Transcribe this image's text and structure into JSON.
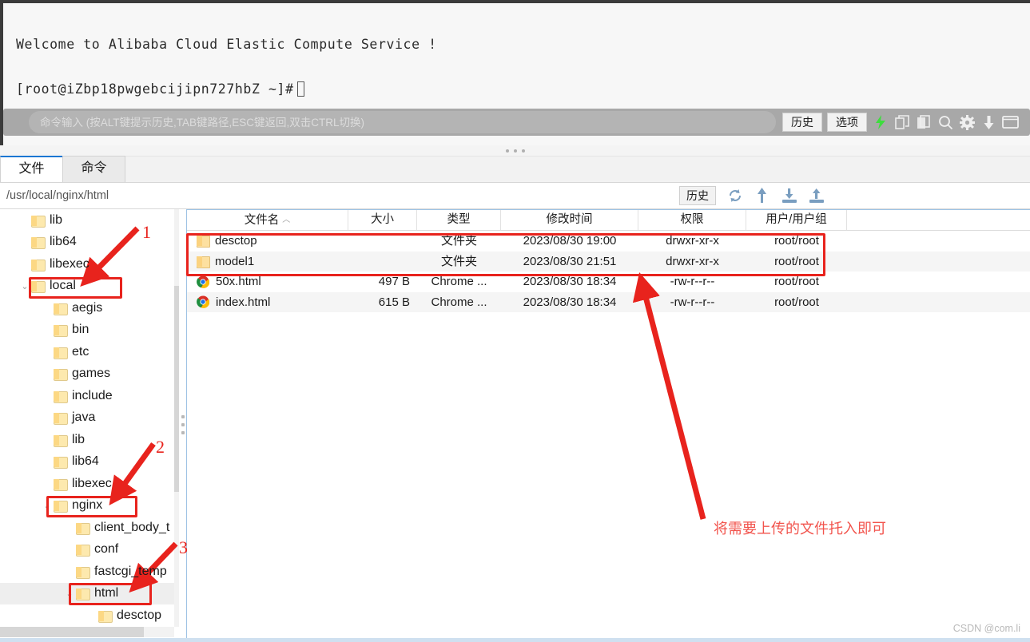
{
  "terminal": {
    "welcome": "Welcome to Alibaba Cloud Elastic Compute Service !",
    "prompt": "[root@iZbp18pwgebcijipn727hbZ ~]#"
  },
  "command_bar": {
    "placeholder": "命令输入 (按ALT键提示历史,TAB键路径,ESC键返回,双击CTRL切换)",
    "value": "",
    "history_label": "历史",
    "options_label": "选项",
    "icons": [
      "lightning-icon",
      "copy-icon",
      "paste-icon",
      "search-icon",
      "gear-icon",
      "download-icon",
      "window-icon"
    ],
    "accent_green": "#3ddd3d",
    "bar_background": "#a8a8a8"
  },
  "tabs": [
    {
      "label": "文件",
      "active": true
    },
    {
      "label": "命令",
      "active": false
    }
  ],
  "path_bar": {
    "path": "/usr/local/nginx/html",
    "history_label": "历史",
    "icons": [
      "refresh-icon",
      "parent-dir-icon",
      "download-file-icon",
      "upload-file-icon"
    ]
  },
  "tree": {
    "items": [
      {
        "label": "lib",
        "indent": 1,
        "chevron": "",
        "selected": false,
        "boxed": false
      },
      {
        "label": "lib64",
        "indent": 1,
        "chevron": "",
        "selected": false,
        "boxed": false
      },
      {
        "label": "libexec",
        "indent": 1,
        "chevron": "",
        "selected": false,
        "boxed": false
      },
      {
        "label": "local",
        "indent": 1,
        "chevron": "v",
        "selected": false,
        "boxed": true
      },
      {
        "label": "aegis",
        "indent": 2,
        "chevron": "",
        "selected": false,
        "boxed": false
      },
      {
        "label": "bin",
        "indent": 2,
        "chevron": "",
        "selected": false,
        "boxed": false
      },
      {
        "label": "etc",
        "indent": 2,
        "chevron": "",
        "selected": false,
        "boxed": false
      },
      {
        "label": "games",
        "indent": 2,
        "chevron": "",
        "selected": false,
        "boxed": false
      },
      {
        "label": "include",
        "indent": 2,
        "chevron": "",
        "selected": false,
        "boxed": false
      },
      {
        "label": "java",
        "indent": 2,
        "chevron": "",
        "selected": false,
        "boxed": false
      },
      {
        "label": "lib",
        "indent": 2,
        "chevron": "",
        "selected": false,
        "boxed": false
      },
      {
        "label": "lib64",
        "indent": 2,
        "chevron": "",
        "selected": false,
        "boxed": false
      },
      {
        "label": "libexec",
        "indent": 2,
        "chevron": "",
        "selected": false,
        "boxed": false
      },
      {
        "label": "nginx",
        "indent": 2,
        "chevron": "v",
        "selected": false,
        "boxed": true
      },
      {
        "label": "client_body_t",
        "indent": 3,
        "chevron": "",
        "selected": false,
        "boxed": false
      },
      {
        "label": "conf",
        "indent": 3,
        "chevron": "",
        "selected": false,
        "boxed": false
      },
      {
        "label": "fastcgi_temp",
        "indent": 3,
        "chevron": "",
        "selected": false,
        "boxed": false
      },
      {
        "label": "html",
        "indent": 3,
        "chevron": "v",
        "selected": true,
        "boxed": true
      },
      {
        "label": "desctop",
        "indent": 4,
        "chevron": "",
        "selected": false,
        "boxed": false
      }
    ]
  },
  "file_list": {
    "columns": [
      {
        "label": "文件名",
        "sort": "asc"
      },
      {
        "label": "大小",
        "sort": ""
      },
      {
        "label": "类型",
        "sort": ""
      },
      {
        "label": "修改时间",
        "sort": ""
      },
      {
        "label": "权限",
        "sort": ""
      },
      {
        "label": "用户/用户组",
        "sort": ""
      }
    ],
    "rows": [
      {
        "icon": "folder-icon",
        "name": "desctop",
        "size": "",
        "type": "文件夹",
        "mtime": "2023/08/30 19:00",
        "perm": "drwxr-xr-x",
        "owner": "root/root"
      },
      {
        "icon": "folder-icon",
        "name": "model1",
        "size": "",
        "type": "文件夹",
        "mtime": "2023/08/30 21:51",
        "perm": "drwxr-xr-x",
        "owner": "root/root"
      },
      {
        "icon": "chrome-icon",
        "name": "50x.html",
        "size": "497 B",
        "type": "Chrome ...",
        "mtime": "2023/08/30 18:34",
        "perm": "-rw-r--r--",
        "owner": "root/root"
      },
      {
        "icon": "chrome-icon",
        "name": "index.html",
        "size": "615 B",
        "type": "Chrome ...",
        "mtime": "2023/08/30 18:34",
        "perm": "-rw-r--r--",
        "owner": "root/root"
      }
    ]
  },
  "annotations": {
    "color": "#e8231d",
    "numbers": [
      {
        "text": "1"
      },
      {
        "text": "2"
      },
      {
        "text": "3"
      }
    ],
    "note": "将需要上传的文件托入即可"
  },
  "watermark": "CSDN @com.li"
}
